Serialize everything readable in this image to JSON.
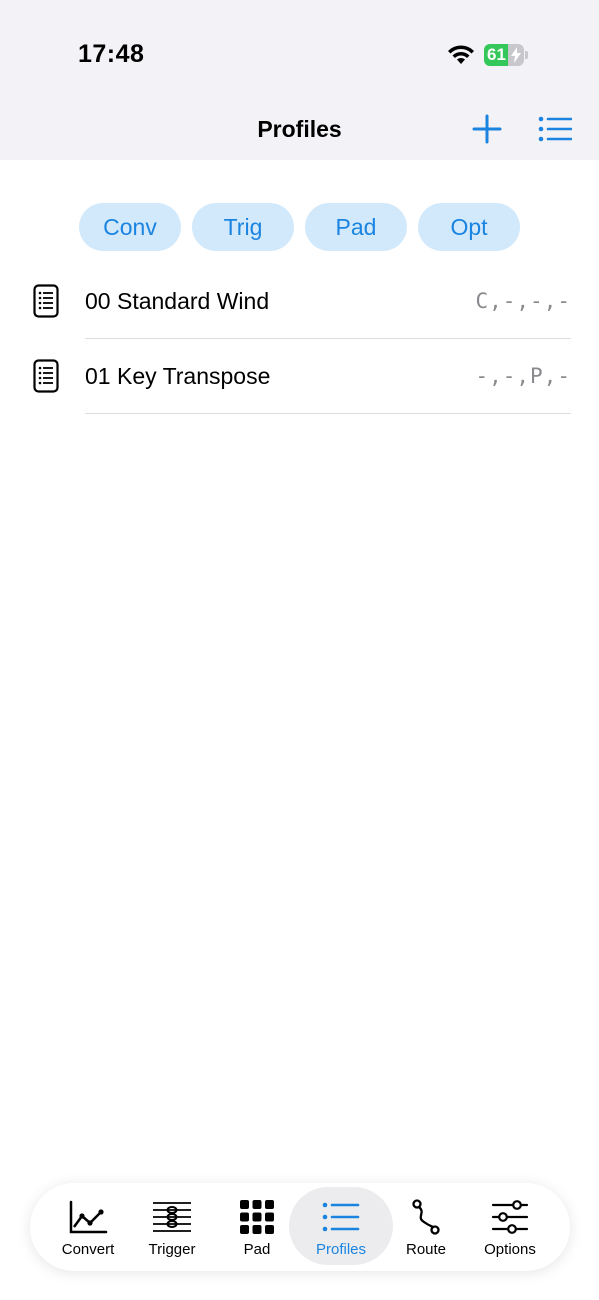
{
  "status": {
    "time": "17:48",
    "battery": "61",
    "battery_level": 0.61
  },
  "nav": {
    "title": "Profiles"
  },
  "chips": [
    "Conv",
    "Trig",
    "Pad",
    "Opt"
  ],
  "profiles": [
    {
      "name": "00 Standard Wind",
      "code": "C,-,-,-"
    },
    {
      "name": "01 Key Transpose",
      "code": "-,-,P,-"
    }
  ],
  "tabs": [
    {
      "label": "Convert",
      "icon": "chart-line-icon"
    },
    {
      "label": "Trigger",
      "icon": "trigger-rows-icon"
    },
    {
      "label": "Pad",
      "icon": "grid-icon"
    },
    {
      "label": "Profiles",
      "icon": "list-icon",
      "active": true
    },
    {
      "label": "Route",
      "icon": "route-icon"
    },
    {
      "label": "Options",
      "icon": "sliders-icon"
    }
  ],
  "colors": {
    "accent": "#1a84e0",
    "chip_bg": "#d2e9fb",
    "header_bg": "#f2f2f7",
    "battery_green": "#34c759"
  }
}
